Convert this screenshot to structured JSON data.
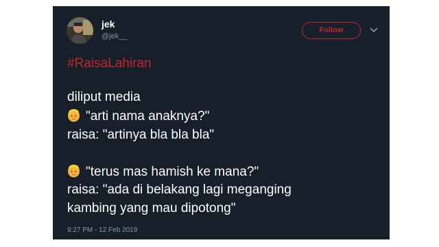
{
  "user": {
    "display_name": "jek",
    "handle": "@jek__"
  },
  "follow_button": {
    "label": "Follow"
  },
  "icons": {
    "menu": "chevron-down-icon",
    "emoji": "older-person-emoji"
  },
  "tweet": {
    "hashtag": "#RaisaLahiran",
    "lines": [
      "diliput media",
      "\"arti nama anaknya?\"",
      "raisa: \"artinya bla bla bla\"",
      "\"terus mas hamish ke mana?\"",
      "raisa: \"ada di belakang lagi meganging",
      "kambing yang mau dipotong\""
    ],
    "timestamp": "9:27 PM - 12 Feb 2019"
  },
  "colors": {
    "card_background": "#161f2a",
    "accent": "#c0282d",
    "secondary_text": "#8899a6",
    "primary_text": "#ffffff"
  }
}
